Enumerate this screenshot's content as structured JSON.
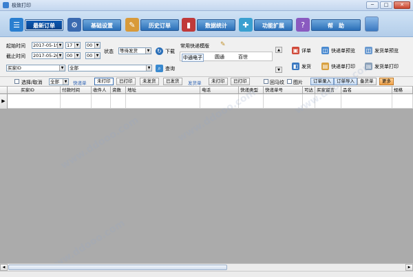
{
  "window": {
    "title": "极致打印",
    "min": "─",
    "max": "□",
    "close": "✕"
  },
  "nav": {
    "latest": "最新订单",
    "basic": "基础设置",
    "history": "历史订单",
    "stats": "数据统计",
    "ext": "功能扩展",
    "help": "帮　助"
  },
  "filters": {
    "start_label": "起始时间",
    "start_date": "2017-05-19",
    "start_hour": "17",
    "start_min": "00",
    "end_label": "截止时间",
    "end_date": "2017-05-26",
    "end_hour": "00",
    "end_min": "00",
    "status_label": "状态",
    "status_value": "等待发货",
    "download": "下载",
    "query": "查询",
    "buyer_field": "买家ID",
    "buyer_value": "全部",
    "common_express_label": "常用快递模版",
    "express_items": [
      "中通电子",
      "圆通",
      "百世"
    ]
  },
  "side_actions": {
    "detail": "详单",
    "ship": "发货",
    "express_preview": "快递单预览",
    "express_print": "快递单打印",
    "invoice_preview": "发货单预览",
    "invoice_print": "发货单打印"
  },
  "actionbar": {
    "select_all": "选择/取消",
    "select_scope": "全部",
    "express_label": "快递单",
    "not_printed": "未打印",
    "printed": "已打印",
    "not_shipped": "未发货",
    "shipped": "已发货",
    "invoice_label": "发货单",
    "invoice_not_printed": "未打印",
    "invoice_printed": "已打印",
    "flag_col": "回马纹",
    "image": "图片",
    "order_entry": "订单录入",
    "order_import": "订单导入",
    "backup": "备货单",
    "more": "更多"
  },
  "grid": {
    "columns": [
      "买家ID",
      "付款时间",
      "收件人",
      "资数",
      "地址",
      "电话",
      "快递类型",
      "快递单号",
      "可达",
      "买家留言",
      "品名",
      "规格"
    ]
  },
  "watermarks": [
    "www.ddooo.com",
    "www.ddooo.com",
    "www.ddooo.com",
    "www.ddooo.com"
  ]
}
